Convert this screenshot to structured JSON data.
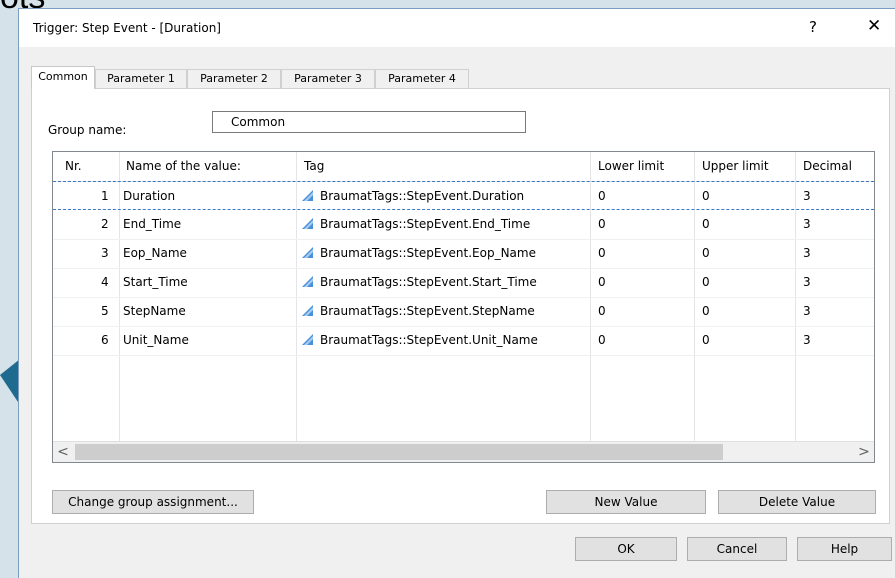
{
  "background": {
    "partial_text": "ots"
  },
  "dialog": {
    "title": "Trigger: Step Event - [Duration]",
    "help_glyph": "?",
    "close_glyph": "✕"
  },
  "tabs": [
    {
      "label": "Common",
      "active": true
    },
    {
      "label": "Parameter 1",
      "active": false
    },
    {
      "label": "Parameter 2",
      "active": false
    },
    {
      "label": "Parameter 3",
      "active": false
    },
    {
      "label": "Parameter 4",
      "active": false
    }
  ],
  "group": {
    "label": "Group name:",
    "value": "Common"
  },
  "table": {
    "columns": [
      "Nr.",
      "Name of the value:",
      "Tag",
      "Lower limit",
      "Upper limit",
      "Decimal"
    ],
    "rows": [
      {
        "nr": "1",
        "name": "Duration",
        "tag": "BraumatTags::StepEvent.Duration",
        "lower": "0",
        "upper": "0",
        "decimal": "3",
        "selected": true
      },
      {
        "nr": "2",
        "name": "End_Time",
        "tag": "BraumatTags::StepEvent.End_Time",
        "lower": "0",
        "upper": "0",
        "decimal": "3",
        "selected": false
      },
      {
        "nr": "3",
        "name": "Eop_Name",
        "tag": "BraumatTags::StepEvent.Eop_Name",
        "lower": "0",
        "upper": "0",
        "decimal": "3",
        "selected": false
      },
      {
        "nr": "4",
        "name": "Start_Time",
        "tag": "BraumatTags::StepEvent.Start_Time",
        "lower": "0",
        "upper": "0",
        "decimal": "3",
        "selected": false
      },
      {
        "nr": "5",
        "name": "StepName",
        "tag": "BraumatTags::StepEvent.StepName",
        "lower": "0",
        "upper": "0",
        "decimal": "3",
        "selected": false
      },
      {
        "nr": "6",
        "name": "Unit_Name",
        "tag": "BraumatTags::StepEvent.Unit_Name",
        "lower": "0",
        "upper": "0",
        "decimal": "3",
        "selected": false
      }
    ],
    "scroll_left": "<",
    "scroll_right": ">"
  },
  "buttons": {
    "change_group": "Change group assignment...",
    "new_value": "New Value",
    "delete_value": "Delete Value",
    "ok": "OK",
    "cancel": "Cancel",
    "help": "Help"
  },
  "colors": {
    "arrow": "#1f6b8f",
    "tag_icon": "#4a90d9",
    "selection_border": "#3b78c4"
  },
  "icons": {
    "tag": "tag-link-icon",
    "pointer": "arrow-pointer-icon"
  }
}
